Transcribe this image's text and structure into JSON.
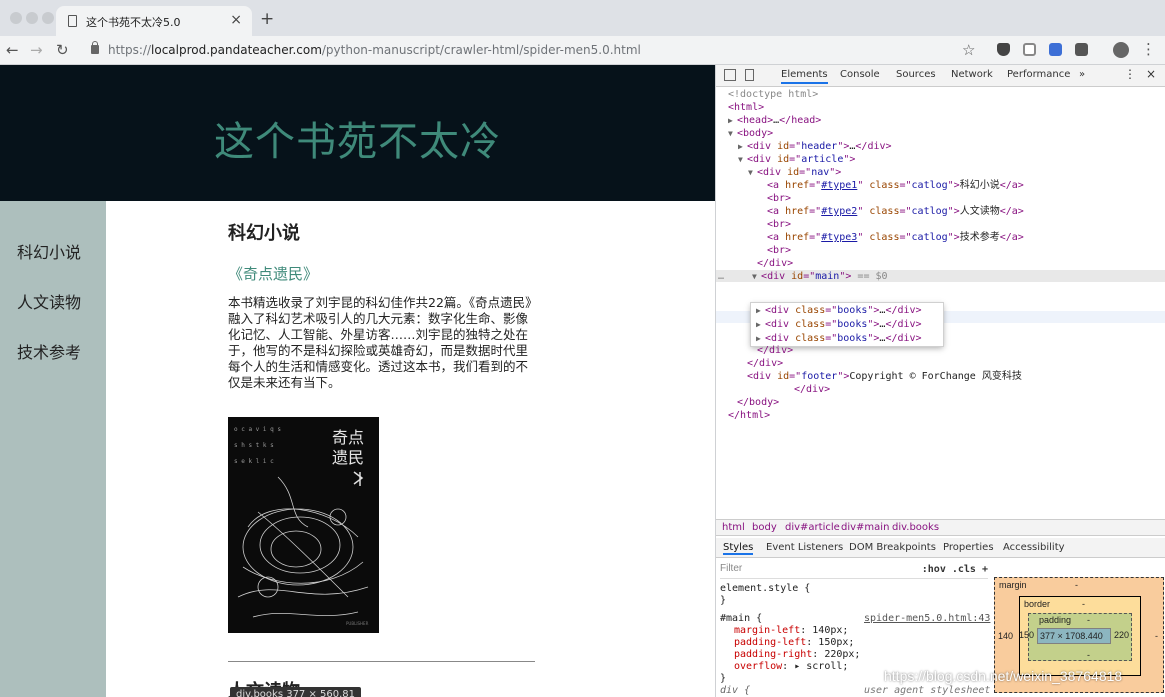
{
  "browser": {
    "tab_title": "这个书苑不太冷5.0",
    "url_scheme": "https://",
    "url_host": "localprod.pandateacher.com",
    "url_path": "/python-manuscript/crawler-html/spider-men5.0.html",
    "icons": [
      "back-icon",
      "forward-icon",
      "reload-icon",
      "lock-icon",
      "star-icon",
      "menu-icon"
    ]
  },
  "site": {
    "title": "这个书苑不太冷",
    "nav": [
      "科幻小说",
      "人文读物",
      "技术参考"
    ],
    "category": "科幻小说",
    "book_title": "《奇点遗民》",
    "description": "本书精选收录了刘宇昆的科幻佳作共22篇。《奇点遗民》融入了科幻艺术吸引人的几大元素：数字化生命、影像化记忆、人工智能、外星访客……刘宇昆的独特之处在于，他写的不是科幻探险或英雄奇幻，而是数据时代里每个人的生活和情感变化。透过这本书，我们看到的不仅是未来还有当下。",
    "cover_title": "奇点遗民",
    "next_category": "人文读物",
    "tooltip": "div.books  377 × 560.81"
  },
  "devtools": {
    "tabs": [
      "Elements",
      "Console",
      "Sources",
      "Network",
      "Performance",
      "»"
    ],
    "active_tab": "Elements",
    "breadcrumbs": [
      "html",
      "body",
      "div#article",
      "div#main",
      "div.books"
    ],
    "subtabs": [
      "Styles",
      "Event Listeners",
      "DOM Breakpoints",
      "Properties",
      "Accessibility"
    ],
    "filter_placeholder": "Filter",
    "filter_opts": ":hov  .cls  +",
    "element_style": "element.style {",
    "close_brace": "}",
    "rule_selector": "#main {",
    "rule_source": "spider-men5.0.html:43",
    "rule_props": [
      {
        "name": "margin-left",
        "value": "140px;"
      },
      {
        "name": "padding-left",
        "value": "150px;"
      },
      {
        "name": "padding-right",
        "value": "220px;"
      },
      {
        "name": "overflow",
        "value": "▸ scroll;"
      }
    ],
    "next_rule": "div {",
    "next_source": "user agent stylesheet",
    "box_model": {
      "margin_label": "margin",
      "margin_value": "-",
      "border_label": "border",
      "border_value": "-",
      "padding_label": "padding",
      "padding_value": "-",
      "content": "377 × 1708.440",
      "left_margin": "140",
      "left_padding": "150",
      "right_padding": "220",
      "dash": "-"
    },
    "dom": {
      "doctype": "<!doctype html>",
      "nav_links": [
        {
          "href": "#type1",
          "text": "科幻小说"
        },
        {
          "href": "#type2",
          "text": "人文读物"
        },
        {
          "href": "#type3",
          "text": "技术参考"
        }
      ],
      "footer_text": "Copyright © ForChange 风变科技",
      "selected_marker": "== $0"
    }
  },
  "watermark": "https://blog.csdn.net/weixin_38764818"
}
